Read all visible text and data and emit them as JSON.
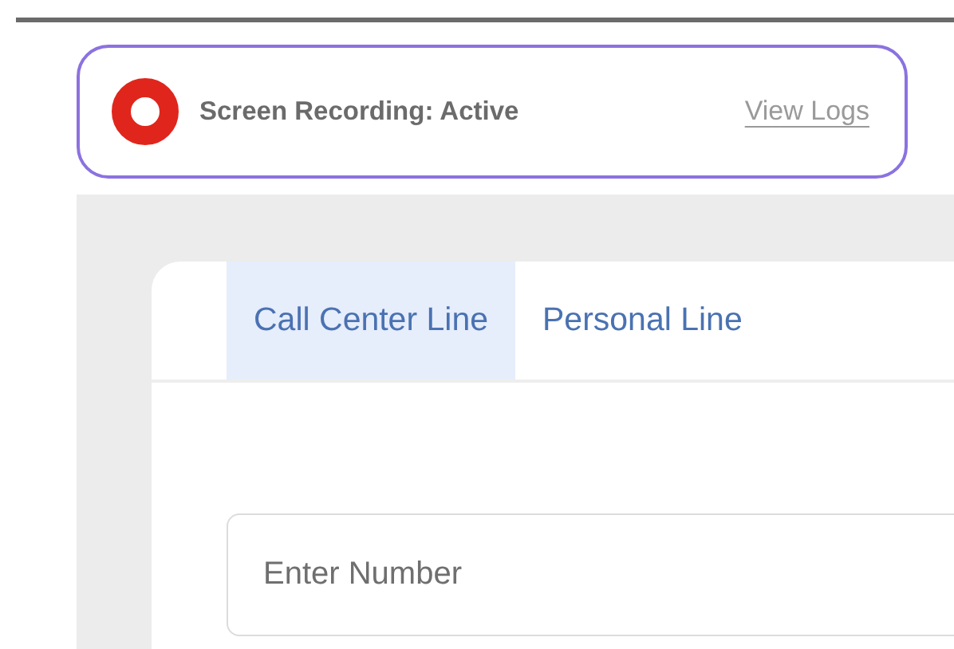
{
  "banner": {
    "title": "Screen Recording: Active",
    "recording": true,
    "link": "View Logs"
  },
  "tabs": [
    {
      "label": "Call Center Line",
      "selected": true
    },
    {
      "label": "Personal Line",
      "selected": false
    }
  ],
  "number_field": {
    "placeholder": "Enter Number"
  }
}
